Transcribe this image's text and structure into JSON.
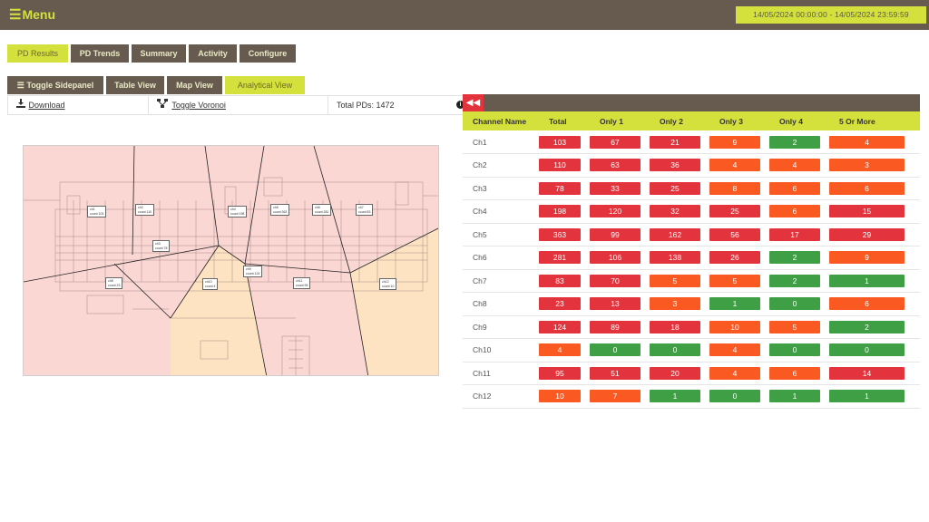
{
  "header": {
    "menu_label": "Menu",
    "date_range": "14/05/2024 00:00:00 - 14/05/2024 23:59:59"
  },
  "nav_tabs": [
    "PD Results",
    "PD Trends",
    "Summary",
    "Activity",
    "Configure"
  ],
  "view_tabs": [
    "Toggle Sidepanel",
    "Table View",
    "Map View",
    "Analytical View"
  ],
  "toolbar": {
    "download": "Download",
    "voronoi": "Toggle Voronoi",
    "total": "Total PDs: 1472"
  },
  "table": {
    "columns": [
      "Channel Name",
      "Total",
      "Only 1",
      "Only 2",
      "Only 3",
      "Only 4",
      "5 Or More"
    ],
    "rows": [
      {
        "name": "Ch1",
        "values": [
          "103",
          "67",
          "21",
          "9",
          "2",
          "4"
        ],
        "colors": [
          "red",
          "red",
          "red",
          "orange",
          "green",
          "orange"
        ]
      },
      {
        "name": "Ch2",
        "values": [
          "110",
          "63",
          "36",
          "4",
          "4",
          "3"
        ],
        "colors": [
          "red",
          "red",
          "red",
          "orange",
          "orange",
          "orange"
        ]
      },
      {
        "name": "Ch3",
        "values": [
          "78",
          "33",
          "25",
          "8",
          "6",
          "6"
        ],
        "colors": [
          "red",
          "red",
          "red",
          "orange",
          "orange",
          "orange"
        ]
      },
      {
        "name": "Ch4",
        "values": [
          "198",
          "120",
          "32",
          "25",
          "6",
          "15"
        ],
        "colors": [
          "red",
          "red",
          "red",
          "red",
          "orange",
          "red"
        ]
      },
      {
        "name": "Ch5",
        "values": [
          "363",
          "99",
          "162",
          "56",
          "17",
          "29"
        ],
        "colors": [
          "red",
          "red",
          "red",
          "red",
          "red",
          "red"
        ]
      },
      {
        "name": "Ch6",
        "values": [
          "281",
          "106",
          "138",
          "26",
          "2",
          "9"
        ],
        "colors": [
          "red",
          "red",
          "red",
          "red",
          "green",
          "orange"
        ]
      },
      {
        "name": "Ch7",
        "values": [
          "83",
          "70",
          "5",
          "5",
          "2",
          "1"
        ],
        "colors": [
          "red",
          "red",
          "orange",
          "orange",
          "green",
          "green"
        ]
      },
      {
        "name": "Ch8",
        "values": [
          "23",
          "13",
          "3",
          "1",
          "0",
          "6"
        ],
        "colors": [
          "red",
          "red",
          "orange",
          "green",
          "green",
          "orange"
        ]
      },
      {
        "name": "Ch9",
        "values": [
          "124",
          "89",
          "18",
          "10",
          "5",
          "2"
        ],
        "colors": [
          "red",
          "red",
          "red",
          "orange",
          "orange",
          "green"
        ]
      },
      {
        "name": "Ch10",
        "values": [
          "4",
          "0",
          "0",
          "4",
          "0",
          "0"
        ],
        "colors": [
          "orange",
          "green",
          "green",
          "orange",
          "green",
          "green"
        ]
      },
      {
        "name": "Ch11",
        "values": [
          "95",
          "51",
          "20",
          "4",
          "6",
          "14"
        ],
        "colors": [
          "red",
          "red",
          "red",
          "orange",
          "orange",
          "red"
        ]
      },
      {
        "name": "Ch12",
        "values": [
          "10",
          "7",
          "1",
          "0",
          "1",
          "1"
        ],
        "colors": [
          "orange",
          "orange",
          "green",
          "green",
          "green",
          "green"
        ]
      }
    ]
  },
  "palette": {
    "red": "#e3343d",
    "orange": "#fa5a22",
    "green": "#3f9f45",
    "brand_dark": "#675b50",
    "brand_accent": "#d4e03b"
  },
  "map_labels": [
    {
      "ch": "ch1",
      "count": "count 103"
    },
    {
      "ch": "ch2",
      "count": "count 110"
    },
    {
      "ch": "ch3",
      "count": "count 78"
    },
    {
      "ch": "ch4",
      "count": "count 198"
    },
    {
      "ch": "ch5",
      "count": "count 363"
    },
    {
      "ch": "ch6",
      "count": "count 281"
    },
    {
      "ch": "ch7",
      "count": "count 83"
    },
    {
      "ch": "ch8",
      "count": "count 23"
    },
    {
      "ch": "ch9",
      "count": "count 124"
    },
    {
      "ch": "ch10",
      "count": "count 4"
    },
    {
      "ch": "ch11",
      "count": "count 95"
    },
    {
      "ch": "ch12",
      "count": "count 10"
    }
  ]
}
